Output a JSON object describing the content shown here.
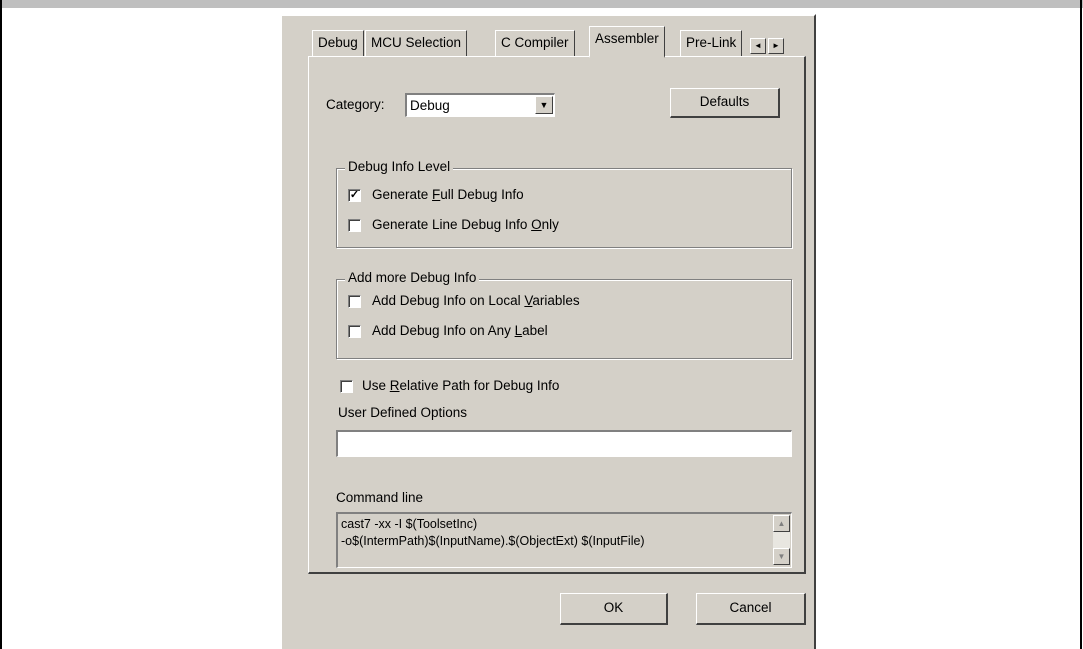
{
  "tabs": [
    {
      "label": "Debug"
    },
    {
      "label": "MCU Selection"
    },
    {
      "label": "C Compiler"
    },
    {
      "label": "Assembler",
      "active": true
    },
    {
      "label": "Pre-Link"
    }
  ],
  "tab_scroll": {
    "left_icon": "arrow-left-icon",
    "right_icon": "arrow-right-icon",
    "left_glyph": "◄",
    "right_glyph": "►"
  },
  "category": {
    "label": "Category:",
    "value": "Debug",
    "dropdown_glyph": "▼"
  },
  "defaults_button": "Defaults",
  "debug_info_level": {
    "title": "Debug Info Level",
    "full": {
      "before": "Generate ",
      "key": "F",
      "after": "ull Debug Info",
      "checked": true
    },
    "line": {
      "before": "Generate Line Debug Info ",
      "key": "O",
      "after": "nly",
      "checked": false
    }
  },
  "add_more_debug_info": {
    "title": "Add more Debug Info",
    "local_vars": {
      "before": "Add Debug Info on Local ",
      "key": "V",
      "after": "ariables",
      "checked": false
    },
    "any_label": {
      "before": "Add Debug Info on Any ",
      "key": "L",
      "after": "abel",
      "checked": false
    }
  },
  "relative_path": {
    "before": "Use ",
    "key": "R",
    "after": "elative Path for Debug Info",
    "checked": false
  },
  "user_options": {
    "label": "User Defined Options",
    "value": ""
  },
  "command_line": {
    "label": "Command line",
    "line1": "cast7 -xx -I $(ToolsetInc)",
    "line2": "-o$(IntermPath)$(InputName).$(ObjectExt) $(InputFile)"
  },
  "scroll_glyphs": {
    "up": "▲",
    "down": "▼"
  },
  "ok_button": "OK",
  "cancel_button": "Cancel",
  "check_glyph": "✓"
}
